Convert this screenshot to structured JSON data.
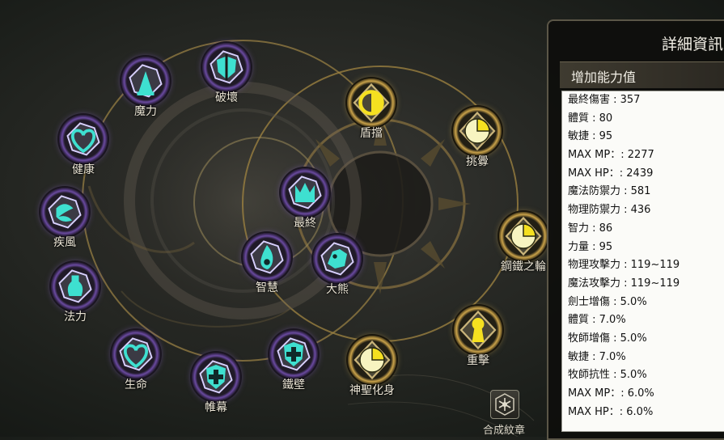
{
  "nodes": [
    {
      "id": "magic-power",
      "label": "魔力",
      "type": "purple",
      "icon": "mage-hat-icon"
    },
    {
      "id": "destroy",
      "label": "破壞",
      "type": "purple",
      "icon": "shield-sword-icon"
    },
    {
      "id": "health",
      "label": "健康",
      "type": "purple",
      "icon": "heart-icon"
    },
    {
      "id": "gale",
      "label": "疾風",
      "type": "purple",
      "icon": "wind-icon"
    },
    {
      "id": "spell-power",
      "label": "法力",
      "type": "purple",
      "icon": "potion-icon"
    },
    {
      "id": "life",
      "label": "生命",
      "type": "purple",
      "icon": "heart-icon"
    },
    {
      "id": "curtain",
      "label": "帷幕",
      "type": "purple",
      "icon": "cross-shield-icon"
    },
    {
      "id": "iron-wall",
      "label": "鐵壁",
      "type": "purple",
      "icon": "cross-shield-icon"
    },
    {
      "id": "final",
      "label": "最終",
      "type": "purple",
      "icon": "crown-icon"
    },
    {
      "id": "wisdom",
      "label": "智慧",
      "type": "purple",
      "icon": "flame-icon"
    },
    {
      "id": "bear",
      "label": "大熊",
      "type": "purple",
      "icon": "bear-icon"
    },
    {
      "id": "block",
      "label": "盾擋",
      "type": "gold",
      "icon": "half-moon-icon"
    },
    {
      "id": "provoke",
      "label": "挑釁",
      "type": "gold",
      "icon": "quarter-pie-icon"
    },
    {
      "id": "steel-wheel",
      "label": "鋼鐵之輪",
      "type": "gold",
      "icon": "quarter-pie-icon"
    },
    {
      "id": "heavy-strike",
      "label": "重擊",
      "type": "gold",
      "icon": "keyhole-icon"
    },
    {
      "id": "holy-incarnation",
      "label": "神聖化身",
      "type": "gold",
      "icon": "quarter-pie-icon"
    }
  ],
  "panel": {
    "title": "詳細資訊",
    "section_header": "增加能力值",
    "stats": [
      "最終傷害 : 357",
      "體質 : 80",
      "敏捷 : 95",
      "MAX MP：: 2277",
      "MAX HP：: 2439",
      "魔法防禦力 : 581",
      "物理防禦力 : 436",
      "智力 : 86",
      "力量 : 95",
      "物理攻擊力 : 119~119",
      "魔法攻擊力 : 119~119",
      "劍士增傷 : 5.0%",
      "體質 : 7.0%",
      "牧師增傷 : 5.0%",
      "敏捷 : 7.0%",
      "牧師抗性 : 5.0%",
      "MAX MP：: 6.0%",
      "MAX HP：: 6.0%"
    ]
  },
  "synthesize": {
    "label": "合成紋章",
    "icon": "snowflake-emblem-icon"
  },
  "colors": {
    "purple_ring": "#8a62c8",
    "gold_ring": "#e0b850",
    "teal_icon": "#3ee0d0",
    "yellow_icon": "#f5e020",
    "panel_bg": "#0e0e0c"
  }
}
